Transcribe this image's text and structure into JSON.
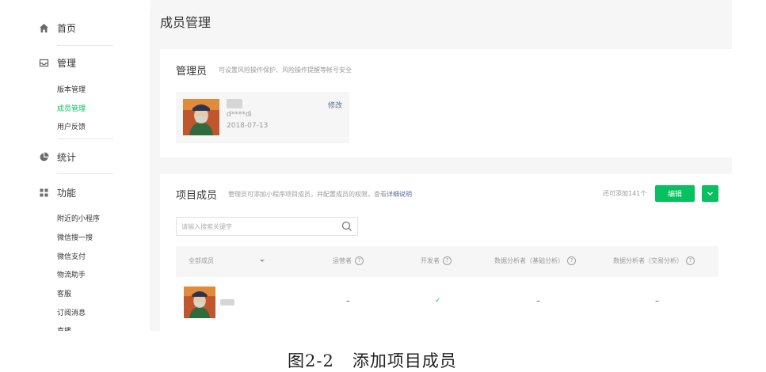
{
  "sidebar": {
    "home": {
      "label": "首页",
      "icon": "home-icon"
    },
    "manage": {
      "label": "管理",
      "icon": "inbox-icon",
      "items": [
        "版本管理",
        "成员管理",
        "用户反馈"
      ],
      "active": "成员管理"
    },
    "stats": {
      "label": "统计",
      "icon": "pie-chart-icon"
    },
    "features": {
      "label": "功能",
      "icon": "grid-icon",
      "items": [
        "附近的小程序",
        "微信搜一搜",
        "微信支付",
        "物流助手",
        "客服",
        "订阅消息",
        "直播"
      ]
    }
  },
  "page": {
    "title": "成员管理"
  },
  "admin_section": {
    "title": "管理员",
    "desc": "可设置风险操作保护、风险操作提醒等帐号安全",
    "admin": {
      "name": "d****di",
      "date": "2018-07-13",
      "edit": "修改"
    }
  },
  "members_section": {
    "title": "项目成员",
    "desc": "管理员可添加小程序项目成员，并配置成员的权限，查看",
    "desc_link": "详细说明",
    "quota": "还可添加141个",
    "edit_button": "编辑",
    "search_placeholder": "请输入搜索关键字",
    "columns": {
      "all": "全部成员",
      "operator": "运营者",
      "developer": "开发者",
      "analyst_basic": "数据分析者（基础分析）",
      "analyst_trade": "数据分析者（交易分析）"
    },
    "help_glyph": "?",
    "row": {
      "operator": "–",
      "developer": "✓",
      "analyst_basic": "–",
      "analyst_trade": "–"
    }
  },
  "caption": "图2-2   添加项目成员",
  "colors": {
    "accent": "#07c160",
    "link": "#576b95",
    "background": "#f6f6f6"
  }
}
